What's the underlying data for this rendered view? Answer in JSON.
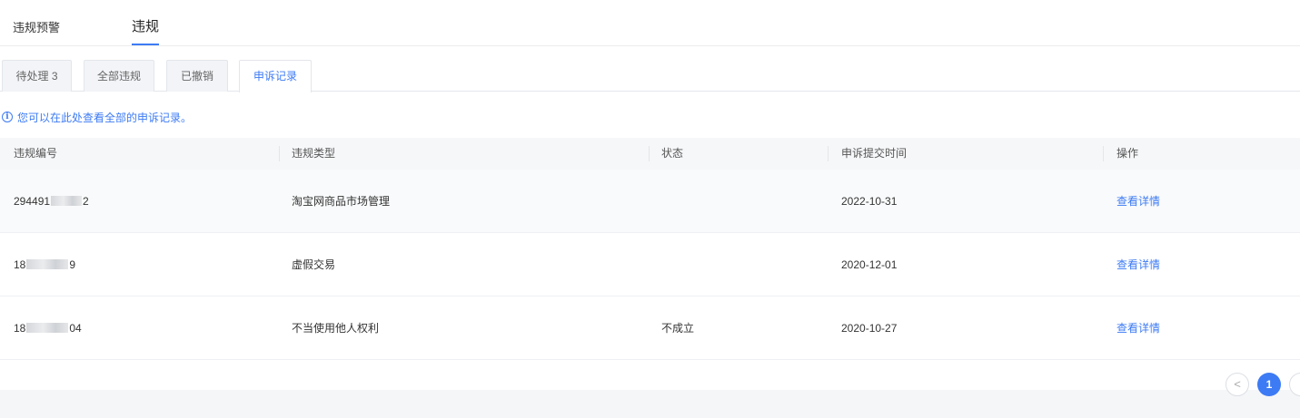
{
  "top_tabs": [
    {
      "label": "违规预警",
      "active": false
    },
    {
      "label": "违规",
      "active": true
    }
  ],
  "sub_tabs": [
    {
      "label": "待处理 3",
      "active": false
    },
    {
      "label": "全部违规",
      "active": false
    },
    {
      "label": "已撤销",
      "active": false
    },
    {
      "label": "申诉记录",
      "active": true
    }
  ],
  "info": {
    "icon": "info-circle-icon",
    "text": "您可以在此处查看全部的申诉记录。"
  },
  "table": {
    "columns": [
      "违规编号",
      "违规类型",
      "状态",
      "申诉提交时间",
      "操作"
    ],
    "rows": [
      {
        "id_prefix": "294491",
        "id_suffix": "2",
        "type": "淘宝网商品市场管理",
        "status": "",
        "time": "2022-10-31",
        "action": "查看详情"
      },
      {
        "id_prefix": "18",
        "id_suffix": "9",
        "type": "虚假交易",
        "status": "",
        "time": "2020-12-01",
        "action": "查看详情"
      },
      {
        "id_prefix": "18",
        "id_suffix": "04",
        "type": "不当使用他人权利",
        "status": "不成立",
        "time": "2020-10-27",
        "action": "查看详情"
      }
    ]
  },
  "pagination": {
    "prev_icon": "chevron-left-icon",
    "prev_glyph": "<",
    "current_page": "1"
  },
  "colors": {
    "accent": "#3d7bf4",
    "header_bg": "#f6f7f9",
    "page_bg": "#f5f6f8"
  }
}
